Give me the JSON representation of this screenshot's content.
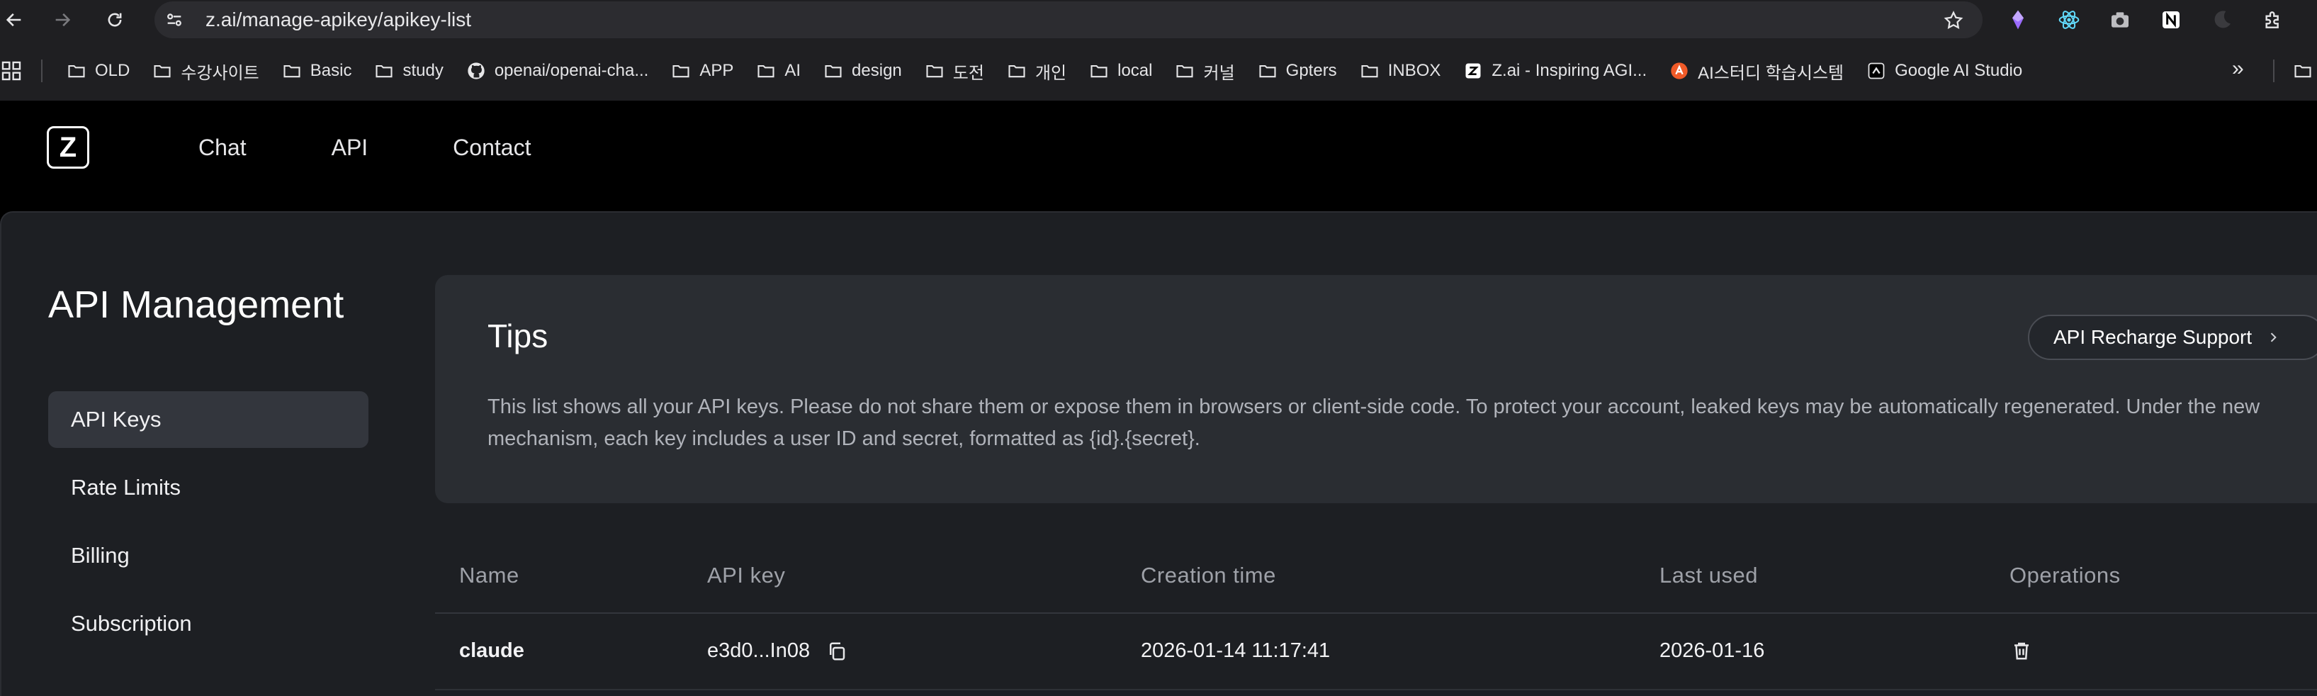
{
  "browser": {
    "url": "z.ai/manage-apikey/apikey-list",
    "bookmarks": [
      "OLD",
      "수강사이트",
      "Basic",
      "study",
      "openai/openai-cha...",
      "APP",
      "AI",
      "design",
      "도전",
      "개인",
      "local",
      "커널",
      "Gpters",
      "INBOX",
      "Z.ai - Inspiring AGI...",
      "AI스터디 학습시스템",
      "Google AI Studio"
    ],
    "more": "»"
  },
  "header": {
    "logo": "Z",
    "nav": [
      "Chat",
      "API",
      "Contact"
    ]
  },
  "page": {
    "title": "API Management"
  },
  "sidebar": {
    "items": [
      "API Keys",
      "Rate Limits",
      "Billing",
      "Subscription"
    ],
    "active": "API Keys"
  },
  "tips": {
    "title": "Tips",
    "text": "This list shows all your API keys. Please do not share them or expose them in browsers or client-side code. To protect your account, leaked keys may be automatically regenerated. Under the new mechanism, each key includes a user ID and secret, formatted as {id}.{secret}.",
    "button": "API Recharge Support"
  },
  "table": {
    "headers": [
      "Name",
      "API key",
      "Creation time",
      "Last used",
      "Operations"
    ],
    "rows": [
      {
        "name": "claude",
        "key": "e3d0...In08",
        "created": "2026-01-14 11:17:41",
        "last_used": "2026-01-16"
      }
    ]
  },
  "colors": {
    "background": "#000000",
    "panel": "#1d1f23",
    "card": "#2a2d32",
    "active_nav": "#33363d",
    "muted_text": "#9ea1a8"
  }
}
